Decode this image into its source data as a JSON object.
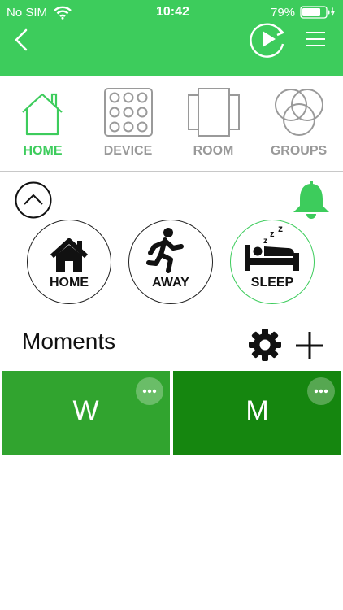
{
  "status_bar": {
    "carrier": "No SIM",
    "time": "10:42",
    "battery": "79%"
  },
  "colors": {
    "brand": "#3dcc5c",
    "tile_1": "#31a42f",
    "tile_2": "#15860f"
  },
  "tabs": [
    {
      "label": "HOME",
      "icon": "house-icon",
      "active": true
    },
    {
      "label": "DEVICE",
      "icon": "device-grid-icon"
    },
    {
      "label": "ROOM",
      "icon": "room-panels-icon"
    },
    {
      "label": "GROUPS",
      "icon": "groups-circles-icon"
    }
  ],
  "modes": [
    {
      "label": "HOME"
    },
    {
      "label": "AWAY"
    },
    {
      "label": "SLEEP",
      "active": true
    }
  ],
  "moments": {
    "title": "Moments",
    "tiles": [
      {
        "label": "W"
      },
      {
        "label": "M"
      }
    ]
  }
}
